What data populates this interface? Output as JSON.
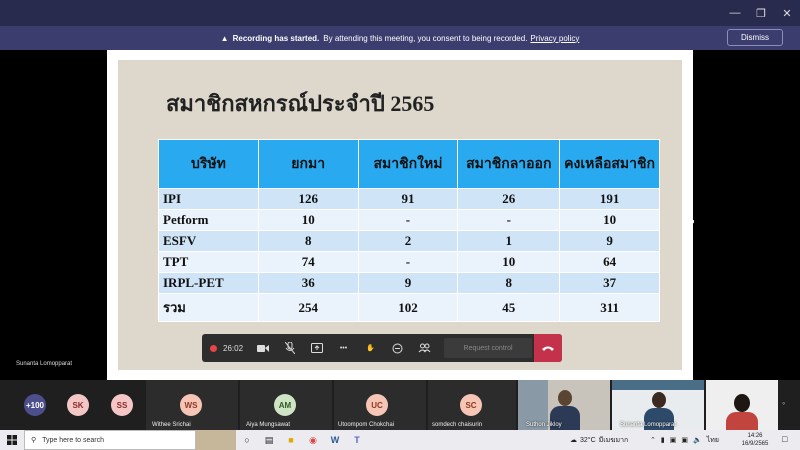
{
  "recording_banner": {
    "title": "Recording has started.",
    "message": "By attending this meeting, you consent to being recorded.",
    "link": "Privacy policy",
    "dismiss": "Dismiss"
  },
  "slide": {
    "title": "สมาชิกสหกรณ์ประจำปี 2565",
    "headers": [
      "บริษัท",
      "ยกมา",
      "สมาชิกใหม่",
      "สมาชิกลาออก",
      "คงเหลือสมาชิก"
    ],
    "rows": [
      [
        "IPI",
        "126",
        "91",
        "26",
        "191"
      ],
      [
        "Petform",
        "10",
        "-",
        "-",
        "10"
      ],
      [
        "ESFV",
        "8",
        "2",
        "1",
        "9"
      ],
      [
        "TPT",
        "74",
        "-",
        "10",
        "64"
      ],
      [
        "IRPL-PET",
        "36",
        "9",
        "8",
        "37"
      ],
      [
        "รวม",
        "254",
        "102",
        "45",
        "311"
      ]
    ]
  },
  "presenter_name": "Sunanta Lomopparat",
  "toolbar": {
    "timer": "26:02",
    "request_control": "Request control"
  },
  "gallery": {
    "overflow_count": "+100",
    "avatars": [
      {
        "initials": "SK",
        "color": "#f4c6c6",
        "text_color": "#8a2a2a"
      },
      {
        "initials": "SS",
        "color": "#f4c6c6",
        "text_color": "#8a2a2a"
      }
    ],
    "tiles": [
      {
        "initials": "WS",
        "name": "Withee Srichai",
        "color": "#f6c5b6",
        "text_color": "#8a3a20"
      },
      {
        "initials": "AM",
        "name": "Aiya Mungsawat",
        "color": "#cfe3c5",
        "text_color": "#2f5a20"
      },
      {
        "initials": "UC",
        "name": "Utoompom Chokchai",
        "color": "#f6c5b6",
        "text_color": "#8a3a20"
      },
      {
        "initials": "SC",
        "name": "somdech chaisurin",
        "color": "#f6c5b6",
        "text_color": "#8a3a20"
      }
    ],
    "video_names": [
      "Suthon Jikloy",
      "Sunanta Lomopparat"
    ]
  },
  "taskbar": {
    "search_placeholder": "Type here to search",
    "temperature": "32°C",
    "weather": "มีเมฆมาก",
    "language": "ไทย",
    "time": "14:26",
    "date": "16/9/2565"
  }
}
